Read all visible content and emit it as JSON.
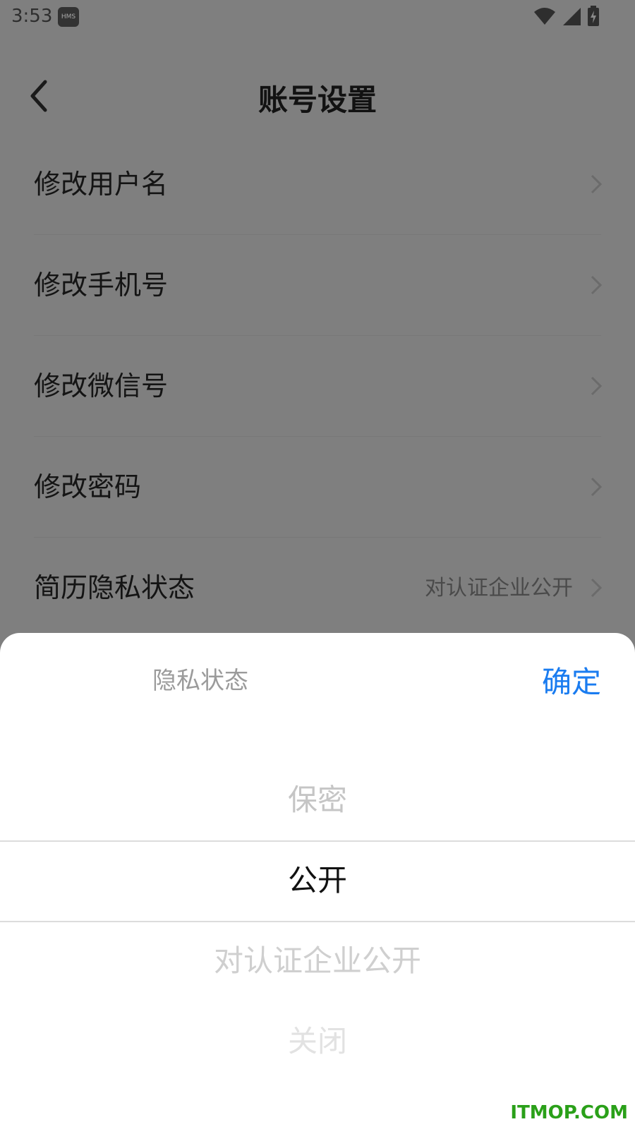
{
  "status_bar": {
    "time": "3:53",
    "hms_badge": "HMS"
  },
  "header": {
    "title": "账号设置"
  },
  "settings": [
    {
      "label": "修改用户名",
      "value": ""
    },
    {
      "label": "修改手机号",
      "value": ""
    },
    {
      "label": "修改微信号",
      "value": ""
    },
    {
      "label": "修改密码",
      "value": ""
    },
    {
      "label": "简历隐私状态",
      "value": "对认证企业公开"
    }
  ],
  "sheet": {
    "title": "隐私状态",
    "confirm": "确定",
    "options": [
      "保密",
      "公开",
      "对认证企业公开",
      "关闭"
    ],
    "selected": "公开"
  },
  "watermark": "ITMOP.COM"
}
